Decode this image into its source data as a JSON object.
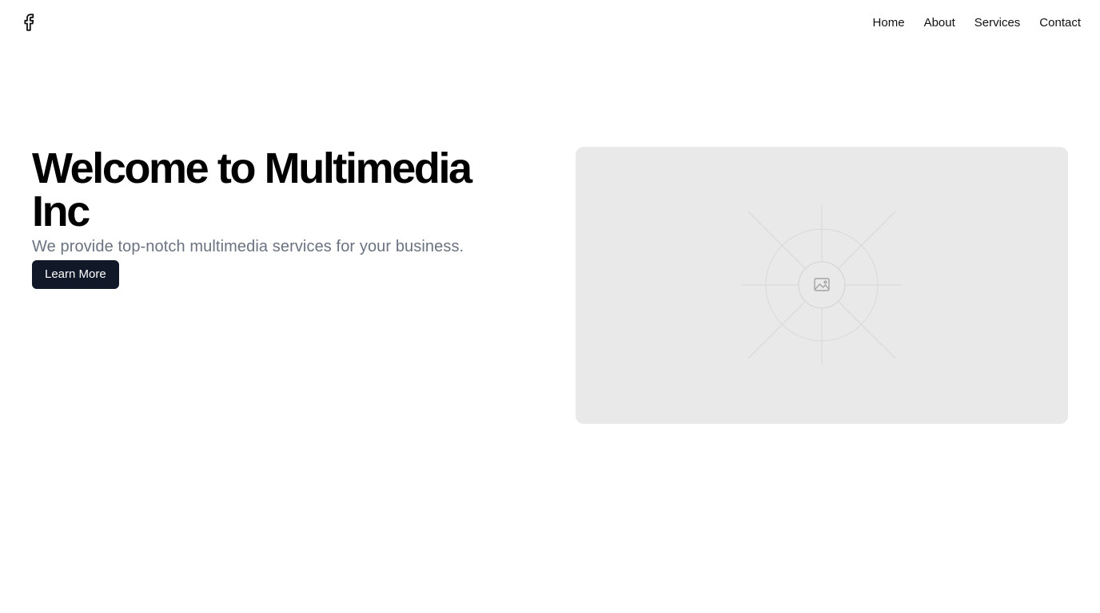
{
  "header": {
    "logo_icon": "facebook-icon",
    "nav": [
      {
        "label": "Home"
      },
      {
        "label": "About"
      },
      {
        "label": "Services"
      },
      {
        "label": "Contact"
      }
    ]
  },
  "hero": {
    "title": "Welcome to Multimedia Inc",
    "subtitle": "We provide top-notch multimedia services for your business.",
    "cta_label": "Learn More",
    "image_icon": "image-placeholder-icon"
  },
  "colors": {
    "cta_background": "#111827",
    "subtitle_text": "#6b7280",
    "placeholder_background": "#e9e9e9"
  }
}
